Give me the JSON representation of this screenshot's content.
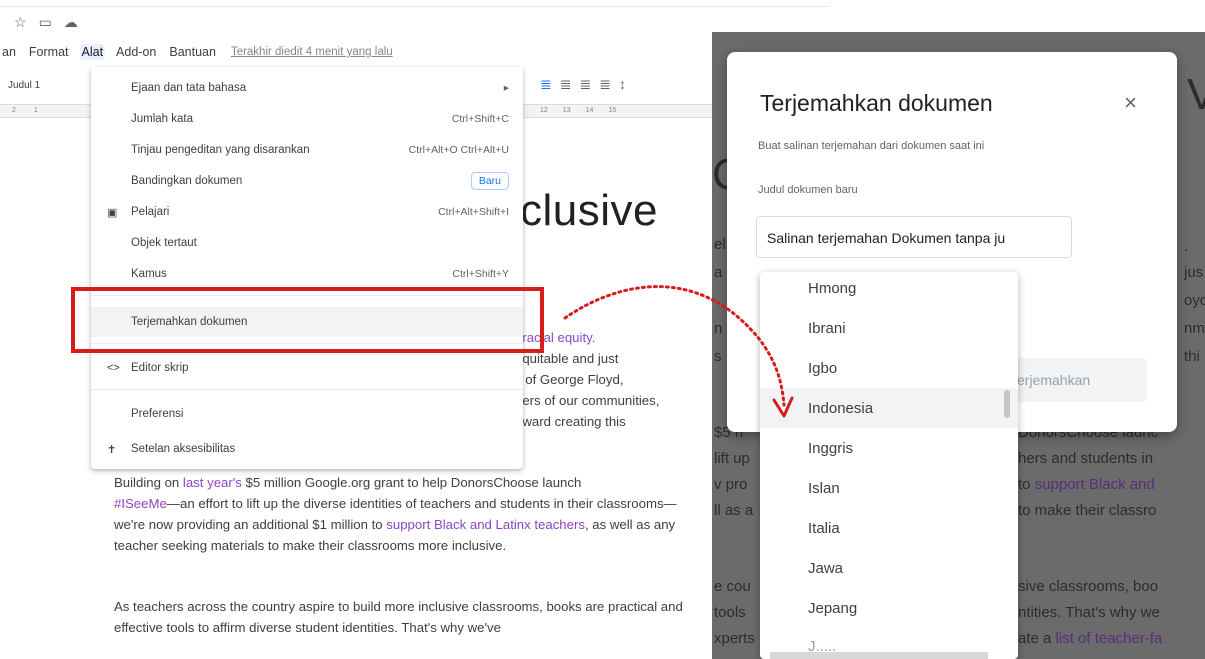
{
  "doc_icons": {
    "star": "☆",
    "folder": "▭",
    "cloud": "☁"
  },
  "menubar": {
    "items": [
      "an",
      "Format",
      "Alat",
      "Add-on",
      "Bantuan"
    ],
    "last_edit": "Terakhir diedit 4 menit yang lalu"
  },
  "toolbar": {
    "style": "Judul 1",
    "ruler_left": [
      "2",
      "1"
    ],
    "ruler_right": [
      "12",
      "13",
      "14",
      "15"
    ]
  },
  "tools_menu": {
    "items": [
      {
        "label": "Ejaan dan tata bahasa",
        "shortcut": "▸"
      },
      {
        "label": "Jumlah kata",
        "shortcut": "Ctrl+Shift+C"
      },
      {
        "label": "Tinjau pengeditan yang disarankan",
        "shortcut": "Ctrl+Alt+O Ctrl+Alt+U"
      },
      {
        "label": "Bandingkan dokumen",
        "badge": "Baru"
      },
      {
        "label": "Pelajari",
        "shortcut": "Ctrl+Alt+Shift+I"
      },
      {
        "label": "Objek tertaut"
      },
      {
        "label": "Kamus",
        "shortcut": "Ctrl+Shift+Y"
      },
      {
        "label": "Terjemahkan dokumen"
      },
      {
        "label": "Editor skrip"
      },
      {
        "label": "Preferensi"
      },
      {
        "label": "Setelan aksesibilitas"
      }
    ]
  },
  "document": {
    "heading_fragment": "clusive",
    "fragments": {
      "f1_link": "t racial equity.",
      "f2": "equitable and just",
      "f3": "s of George Floyd,",
      "f4": "bers of our communities,",
      "f5": "oward creating this"
    },
    "para1": {
      "t1": "Building on ",
      "l1": "last year's",
      "t2": " $5 million Google.org grant to help DonorsChoose launch",
      "l2": "#ISeeMe",
      "t3": "—an effort to lift up the diverse identities of teachers and students in their classrooms—we're now providing an additional $1 million to ",
      "l3": "support Black and Latinx teachers",
      "t4": ", as well as any teacher seeking materials to make their classrooms more inclusive."
    },
    "para2": "As teachers across the country aspire to build more inclusive classrooms, books are practical and effective tools to affirm diverse student identities. That's why we've"
  },
  "dialog": {
    "title": "Terjemahkan dokumen",
    "close": "×",
    "description": "Buat salinan terjemahan dari dokumen saat ini",
    "field_label": "Judul dokumen baru",
    "field_value": "Salinan terjemahan Dokumen tanpa ju",
    "translate_button": "erjemahkan"
  },
  "languages": {
    "items": [
      "Hmong",
      "Ibrani",
      "Igbo",
      "Indonesia",
      "Inggris",
      "Islan",
      "Italia",
      "Jawa",
      "Jepang"
    ],
    "selected": "Indonesia",
    "partial": "J....."
  },
  "background_fragments": {
    "big": "V",
    "big2": "C",
    "r1": ".",
    "r2": "jus",
    "r3": "oyd",
    "r4": "nm",
    "r5": "thi",
    "l1": "el",
    "l2": "a",
    "l3": "n",
    "l4": "s",
    "mid1": "DonorsChoose launc",
    "mid2": "hers and students in",
    "mid3": " to ",
    "mid3_link": "support Black and",
    "mid4": " to make their classro",
    "left1": "$5 n",
    "left2": "lift up",
    "left3": "v pro",
    "left4": "ll as a",
    "low1": "sive classrooms, boo",
    "low2": "ntities. That's why we",
    "low3": "ate a ",
    "low3_link": "list of teacher-fa",
    "lowl1": "e cou",
    "lowl2": "tools",
    "lowl3": "xperts"
  },
  "colors": {
    "accent": "#1a73e8",
    "highlight_box": "#d81c1c",
    "link": "#8e44c4",
    "overlay": "#6b6b6b"
  }
}
